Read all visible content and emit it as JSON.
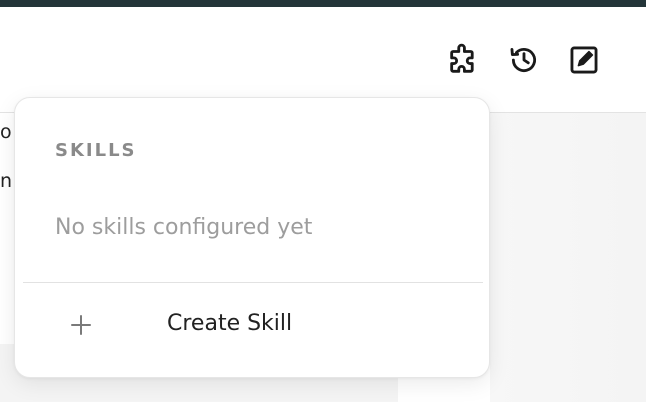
{
  "colors": {
    "top_bar": "#243539",
    "heading_muted": "#8a8a8a",
    "empty_text": "#9d9d9d",
    "text_primary": "#222222",
    "icon": "#1a1a1a"
  },
  "header": {
    "buttons": [
      {
        "name": "skills",
        "icon": "puzzle-icon"
      },
      {
        "name": "history",
        "icon": "history-icon"
      },
      {
        "name": "new-chat",
        "icon": "compose-icon"
      }
    ]
  },
  "background": {
    "text_line_1": "o",
    "text_line_2": "n"
  },
  "skills_menu": {
    "heading": "SKILLS",
    "empty_message": "No skills configured yet",
    "create_label": "Create Skill",
    "create_icon": "plus-icon"
  }
}
